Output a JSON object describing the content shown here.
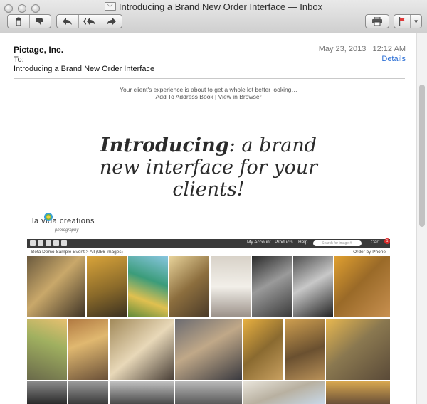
{
  "window": {
    "title": "Introducing a Brand New Order Interface — Inbox"
  },
  "toolbar": {
    "delete_icon": "trash-icon",
    "junk_icon": "thumbs-down-icon",
    "reply_icon": "reply-icon",
    "reply_all_icon": "reply-all-icon",
    "forward_icon": "forward-icon",
    "print_icon": "printer-icon",
    "flag_icon": "flag-icon"
  },
  "message": {
    "from": "Pictage, Inc.",
    "to_label": "To:",
    "subject": "Introducing a Brand New Order Interface",
    "date": "May 23, 2013   12:12 AM",
    "details_link": "Details"
  },
  "email": {
    "preheader": "Your client's experience is about to get a whole lot better looking…",
    "add_to_address_book": "Add To Address Book",
    "separator": "|",
    "view_in_browser": "View in Browser",
    "headline_bold": "Introducing",
    "headline_rest_1": ": a brand",
    "headline_line2": "new interface for your",
    "headline_line3": "clients!",
    "logo_text": "la vida creations",
    "logo_sub": "photography"
  },
  "embedded": {
    "menu_account": "My Account",
    "menu_products": "Products",
    "menu_help": "Help",
    "search_placeholder": "Search for image #",
    "cart": "Cart",
    "cart_count": "1",
    "breadcrumb": "Beta Demo Sample Event > All (956 images)",
    "order_mode": "Order by Phone"
  },
  "colors": {
    "link": "#2b6fd6",
    "badge": "#d92c2c"
  }
}
